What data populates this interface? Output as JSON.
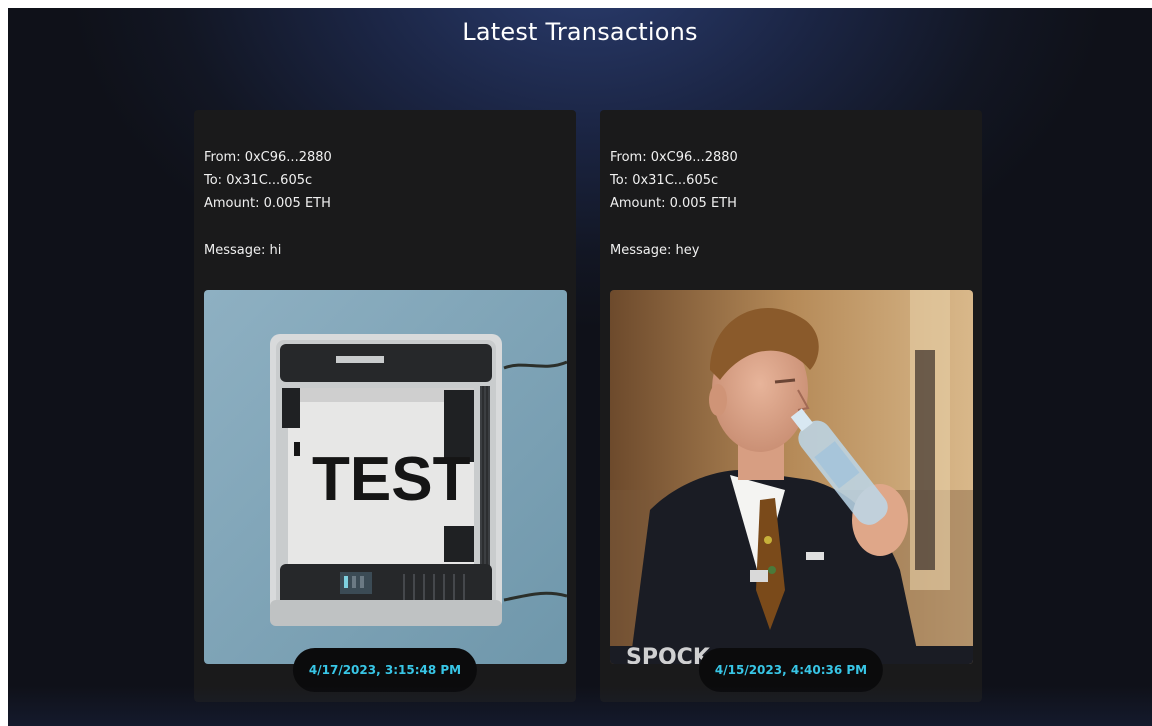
{
  "page": {
    "title": "Latest Transactions"
  },
  "transactions": [
    {
      "from_label": "From: 0xC96...2880",
      "to_label": "To: 0x31C...605c",
      "amount_label": "Amount: 0.005 ETH",
      "message_label": "Message: hi",
      "image_text": "TEST",
      "timestamp": "4/17/2023, 3:15:48 PM"
    },
    {
      "from_label": "From: 0xC96...2880",
      "to_label": "To: 0x31C...605c",
      "amount_label": "Amount: 0.005 ETH",
      "message_label": "Message: hey",
      "timestamp": "4/15/2023, 4:40:36 PM"
    }
  ],
  "colors": {
    "accent": "#38c6e6",
    "card_bg": "#1a1a1b"
  }
}
